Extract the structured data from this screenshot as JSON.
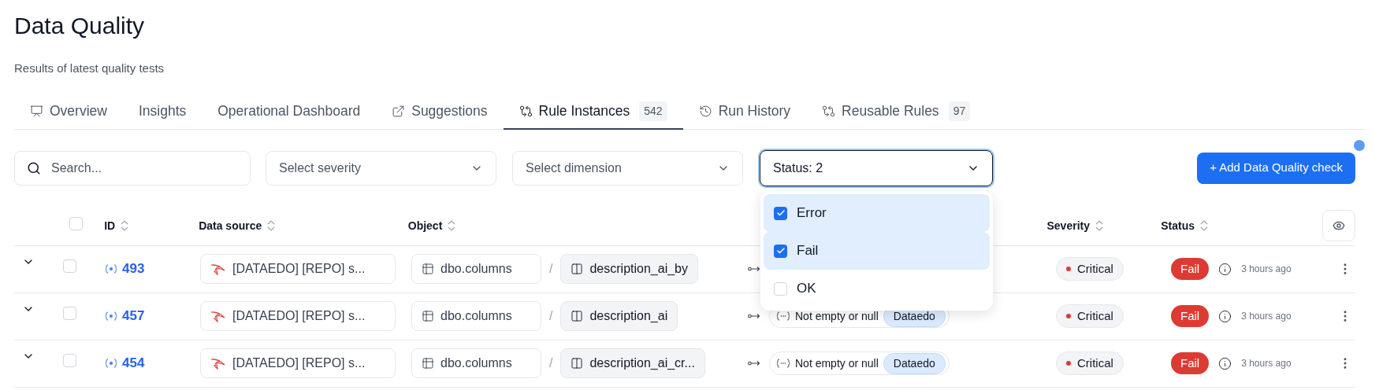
{
  "page": {
    "title": "Data Quality",
    "subtitle": "Results of latest quality tests"
  },
  "tabs": [
    {
      "label": "Overview",
      "selected": false
    },
    {
      "label": "Insights",
      "selected": false
    },
    {
      "label": "Operational Dashboard",
      "selected": false
    },
    {
      "label": "Suggestions",
      "selected": false
    },
    {
      "label": "Rule Instances",
      "count": "542",
      "selected": true
    },
    {
      "label": "Run History",
      "selected": false
    },
    {
      "label": "Reusable Rules",
      "count": "97",
      "selected": false
    }
  ],
  "filters": {
    "search": {
      "placeholder": "Search..."
    },
    "severity": {
      "placeholder": "Select severity"
    },
    "dimension": {
      "placeholder": "Select dimension"
    },
    "status": {
      "value": "Status: 2",
      "expanded": true
    }
  },
  "status_options": [
    {
      "label": "Error",
      "checked": true
    },
    {
      "label": "Fail",
      "checked": true
    },
    {
      "label": "OK",
      "checked": false
    }
  ],
  "add_button": "+ Add Data Quality check",
  "table": {
    "select_all_checked": false,
    "columns": [
      "ID",
      "Data source",
      "Object",
      "Severity",
      "Status"
    ],
    "rows": [
      {
        "id": "493",
        "data_source": "[DATAEDO] [REPO] s...",
        "object": "dbo.columns",
        "separator": "/",
        "column": "description_ai_by",
        "severity": "Critical",
        "status": "Fail",
        "time": "3 hours ago",
        "checked": false
      },
      {
        "id": "457",
        "data_source": "[DATAEDO] [REPO] s...",
        "object": "dbo.columns",
        "separator": "/",
        "column": "description_ai",
        "rule": "Not empty or null",
        "rule_tag": "Dataedo",
        "severity": "Critical",
        "status": "Fail",
        "time": "3 hours ago",
        "checked": false
      },
      {
        "id": "454",
        "data_source": "[DATAEDO] [REPO] s...",
        "object": "dbo.columns",
        "separator": "/",
        "column": "description_ai_cr...",
        "rule": "Not empty or null",
        "rule_tag": "Dataedo",
        "severity": "Critical",
        "status": "Fail",
        "time": "3 hours ago",
        "checked": false
      }
    ]
  }
}
